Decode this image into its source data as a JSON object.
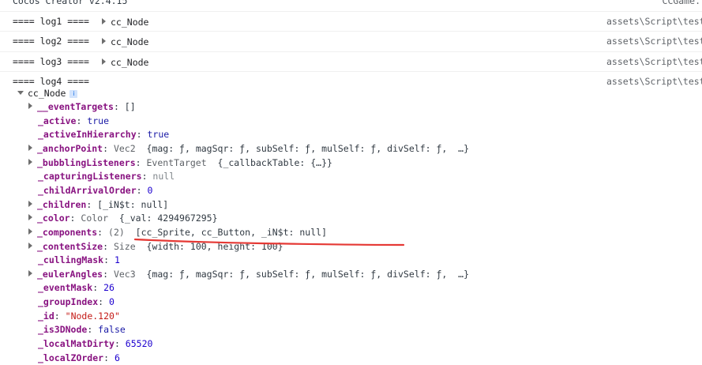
{
  "header": {
    "title": "Cocos Creator v2.4.15",
    "source": "CCGame."
  },
  "logs": [
    {
      "label": "==== log1 ====",
      "object": "cc_Node",
      "source": "assets\\Script\\test"
    },
    {
      "label": "==== log2 ====",
      "object": "cc_Node",
      "source": "assets\\Script\\test"
    },
    {
      "label": "==== log3 ====",
      "object": "cc_Node",
      "source": "assets\\Script\\test"
    },
    {
      "label": "==== log4 ====",
      "source": "assets\\Script\\test"
    }
  ],
  "tree": {
    "root": "cc_Node",
    "info_icon": "i",
    "properties": [
      {
        "key": "__eventTargets",
        "expandable": true,
        "sep": ": ",
        "value": "[]",
        "vclass": "dim"
      },
      {
        "key": "_active",
        "expandable": false,
        "sep": ": ",
        "value": "true",
        "vclass": "kw"
      },
      {
        "key": "_activeInHierarchy",
        "expandable": false,
        "sep": ": ",
        "value": "true",
        "vclass": "kw"
      },
      {
        "key": "_anchorPoint",
        "expandable": true,
        "sep": ": ",
        "type": "Vec2",
        "value": "{mag: ƒ, magSqr: ƒ, subSelf: ƒ, mulSelf: ƒ, divSelf: ƒ,  …}",
        "vclass": "dim"
      },
      {
        "key": "_bubblingListeners",
        "expandable": true,
        "sep": ": ",
        "type": "EventTarget",
        "value": "{_callbackTable: {…}}",
        "vclass": "dim"
      },
      {
        "key": "_capturingListeners",
        "expandable": false,
        "sep": ": ",
        "value": "null",
        "vclass": "nul"
      },
      {
        "key": "_childArrivalOrder",
        "expandable": false,
        "sep": ": ",
        "value": "0",
        "vclass": "num"
      },
      {
        "key": "_children",
        "expandable": true,
        "sep": ": ",
        "value": "[_iN$t: null]",
        "vclass": "dim"
      },
      {
        "key": "_color",
        "expandable": true,
        "sep": ": ",
        "type": "Color",
        "value": "{_val: 4294967295}",
        "vclass": "dim"
      },
      {
        "key": "_components",
        "expandable": true,
        "sep": ": ",
        "type": "(2)",
        "value": "[cc_Sprite, cc_Button, _iN$t: null]",
        "vclass": "dim"
      },
      {
        "key": "_contentSize",
        "expandable": true,
        "sep": ": ",
        "type": "Size",
        "value": "{width: 100, height: 100}",
        "vclass": "dim"
      },
      {
        "key": "_cullingMask",
        "expandable": false,
        "sep": ": ",
        "value": "1",
        "vclass": "num"
      },
      {
        "key": "_eulerAngles",
        "expandable": true,
        "sep": ": ",
        "type": "Vec3",
        "value": "{mag: ƒ, magSqr: ƒ, subSelf: ƒ, mulSelf: ƒ, divSelf: ƒ,  …}",
        "vclass": "dim"
      },
      {
        "key": "_eventMask",
        "expandable": false,
        "sep": ": ",
        "value": "26",
        "vclass": "num"
      },
      {
        "key": "_groupIndex",
        "expandable": false,
        "sep": ": ",
        "value": "0",
        "vclass": "num"
      },
      {
        "key": "_id",
        "expandable": false,
        "sep": ": ",
        "value": "\"Node.120\"",
        "vclass": "str"
      },
      {
        "key": "_is3DNode",
        "expandable": false,
        "sep": ": ",
        "value": "false",
        "vclass": "kw"
      },
      {
        "key": "_localMatDirty",
        "expandable": false,
        "sep": ": ",
        "value": "65520",
        "vclass": "num"
      },
      {
        "key": "_localZOrder",
        "expandable": false,
        "sep": ": ",
        "value": "6",
        "vclass": "num"
      }
    ]
  },
  "colors": {
    "key": "#881280",
    "number": "#1c00cf",
    "string": "#c41a16",
    "null": "#80868b",
    "annotation": "#e53935"
  }
}
